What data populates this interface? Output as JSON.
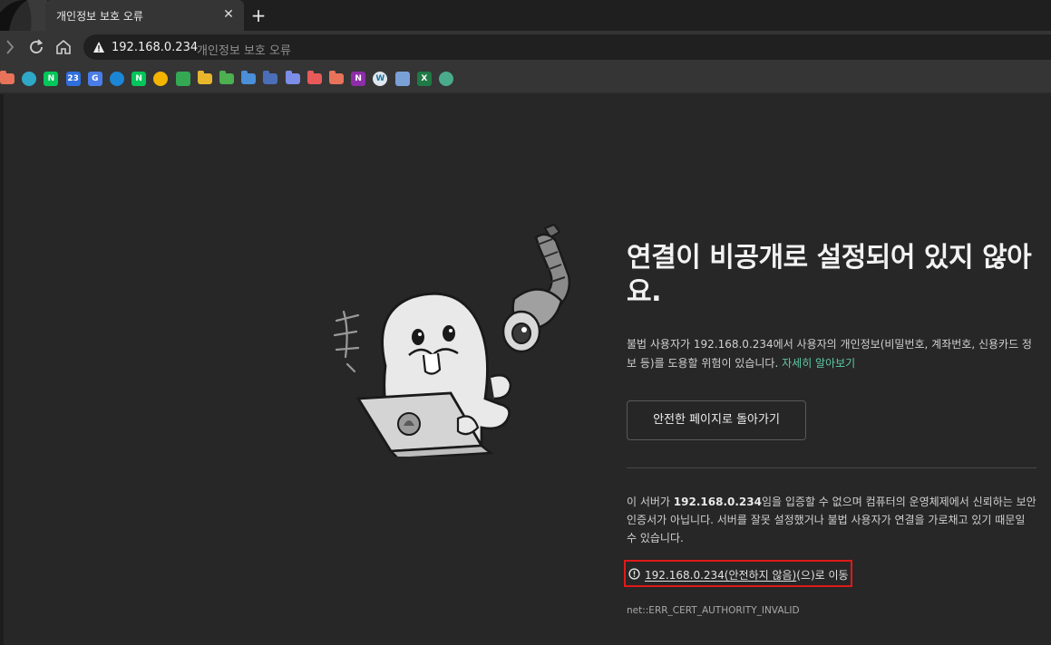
{
  "browser": {
    "tab": {
      "title": "개인정보 보호 오류"
    },
    "new_tab_symbol": "+",
    "close_symbol": "✕",
    "address": {
      "host": "192.168.0.234",
      "note": "개인정보 보호 오류"
    },
    "bookmarks": [
      {
        "icon": "folder-icon",
        "color": "#e8735a"
      },
      {
        "icon": "edge-favicon",
        "color": "#2fa8c8"
      },
      {
        "icon": "naver-favicon",
        "color": "#03c75a",
        "text": "N"
      },
      {
        "icon": "calendar-favicon",
        "color": "#2f6fdd",
        "text": "23"
      },
      {
        "icon": "translate-favicon",
        "color": "#4a7de8",
        "text": "G"
      },
      {
        "icon": "edge-favicon-2",
        "color": "#1b86d6"
      },
      {
        "icon": "naver-favicon-2",
        "color": "#03c75a",
        "text": "N"
      },
      {
        "icon": "maps-favicon",
        "color": "#f4b400"
      },
      {
        "icon": "maps-search-favicon",
        "color": "#34a853"
      },
      {
        "icon": "folder-icon",
        "color": "#e8b62c"
      },
      {
        "icon": "folder-icon",
        "color": "#4caf50"
      },
      {
        "icon": "folder-icon",
        "color": "#4a8fd8"
      },
      {
        "icon": "folder-icon",
        "color": "#4a6fb8"
      },
      {
        "icon": "folder-icon",
        "color": "#7c8ee8"
      },
      {
        "icon": "folder-icon",
        "color": "#e85a5a"
      },
      {
        "icon": "folder-icon",
        "color": "#e8735a"
      },
      {
        "icon": "onenote-favicon",
        "color": "#8e2da8",
        "text": "N"
      },
      {
        "icon": "wordpress-favicon",
        "color": "#dfe6ee",
        "text": "W"
      },
      {
        "icon": "grid-app-favicon",
        "color": "#7aa0d8"
      },
      {
        "icon": "excel-favicon",
        "color": "#1f7a45",
        "text": "X"
      },
      {
        "icon": "chatgpt-favicon",
        "color": "#4aaa8c"
      }
    ]
  },
  "page": {
    "headline": "연결이 비공개로 설정되어 있지 않아요.",
    "description": "불법 사용자가 192.168.0.234에서 사용자의 개인정보(비밀번호, 계좌번호, 신용카드 정보 등)를 도용할 위험이 있습니다.",
    "learn_more": "자세히 알아보기",
    "back_button": "안전한 페이지로 돌아가기",
    "detail_prefix": "이 서버가 ",
    "detail_host": "192.168.0.234",
    "detail_suffix": "임을 입증할 수 없으며 컴퓨터의 운영체제에서 신뢰하는 보안 인증서가 아닙니다. 서버를 잘못 설정했거나 불법 사용자가 연결을 가로채고 있기 때문일 수 있습니다.",
    "proceed_link": "192.168.0.234(안전하지 않음)",
    "proceed_suffix": "(으)로 이동",
    "error_code": "net::ERR_CERT_AUTHORITY_INVALID"
  },
  "colors": {
    "accent_link": "#5fc9a4",
    "highlight_box": "#e01919"
  }
}
